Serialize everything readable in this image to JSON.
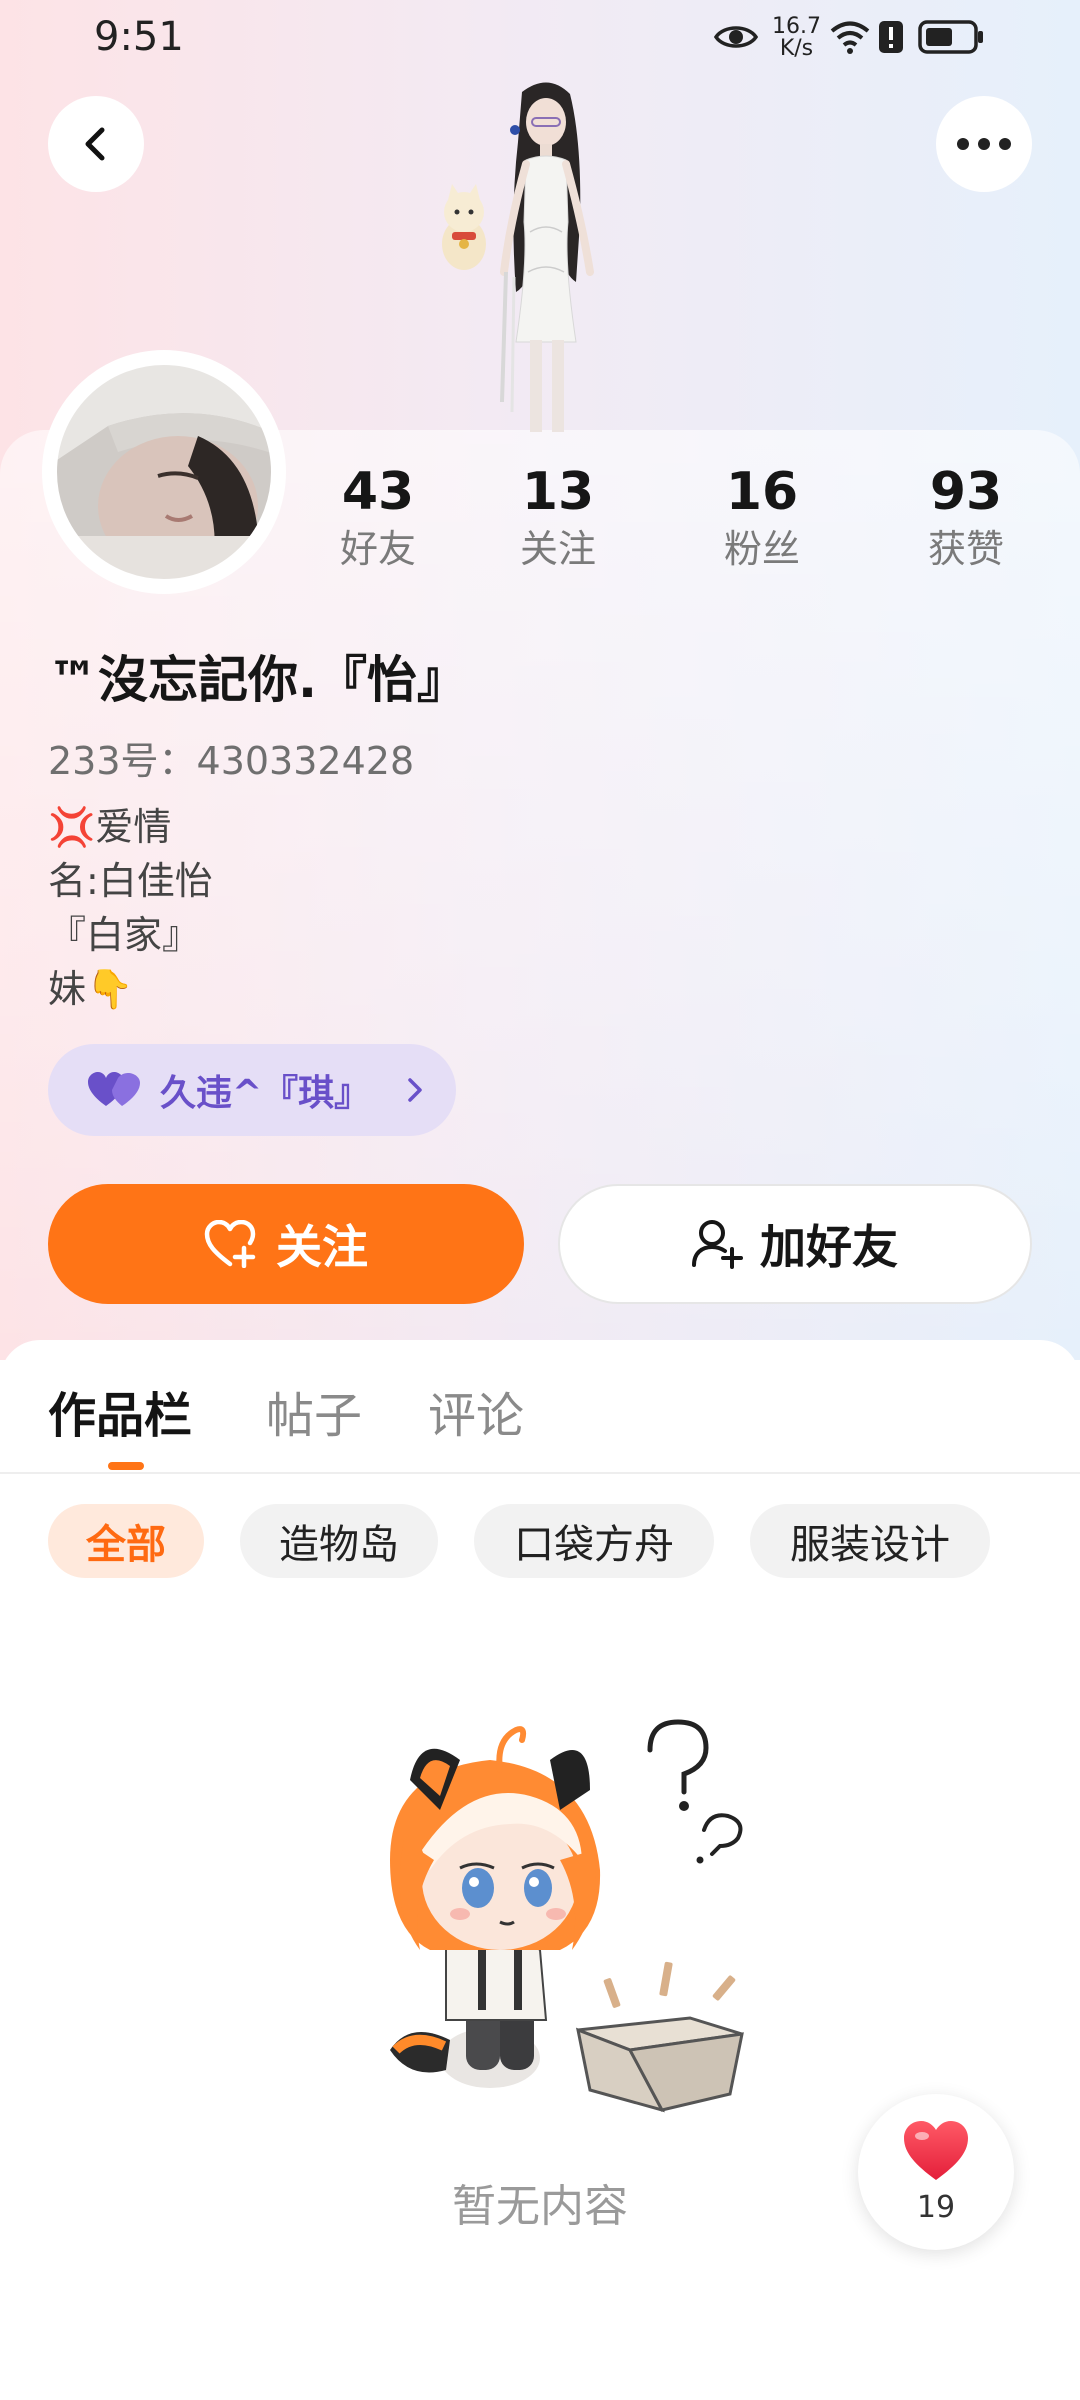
{
  "status_bar": {
    "time": "9:51",
    "speed_value": "16.7",
    "speed_unit": "K/s",
    "icons": [
      "eye-icon",
      "wifi-icon",
      "alert-icon",
      "battery-icon"
    ]
  },
  "nav": {
    "back_icon": "chevron-left-icon",
    "more_icon": "more-dots-icon"
  },
  "profile": {
    "stats": [
      {
        "value": "43",
        "label": "好友"
      },
      {
        "value": "13",
        "label": "关注"
      },
      {
        "value": "16",
        "label": "粉丝"
      },
      {
        "value": "93",
        "label": "获赞"
      }
    ],
    "name": "™沒忘記你.『怡』",
    "id_line": "233号：430332428",
    "bio": [
      "💢爱情",
      "名:白佳怡",
      "『白家』",
      "妹👇"
    ],
    "relation_tag": "久违^『琪』"
  },
  "actions": {
    "follow_label": "关注",
    "add_friend_label": "加好友"
  },
  "tabs": [
    {
      "label": "作品栏",
      "active": true
    },
    {
      "label": "帖子",
      "active": false
    },
    {
      "label": "评论",
      "active": false
    }
  ],
  "filters": [
    {
      "label": "全部",
      "active": true
    },
    {
      "label": "造物岛",
      "active": false
    },
    {
      "label": "口袋方舟",
      "active": false
    },
    {
      "label": "服装设计",
      "active": false
    }
  ],
  "empty_state": {
    "text": "暂无内容"
  },
  "like_float": {
    "count": "19"
  },
  "colors": {
    "accent": "#ff7416",
    "tag_text": "#6950c9",
    "tag_bg": "#e5def6"
  }
}
